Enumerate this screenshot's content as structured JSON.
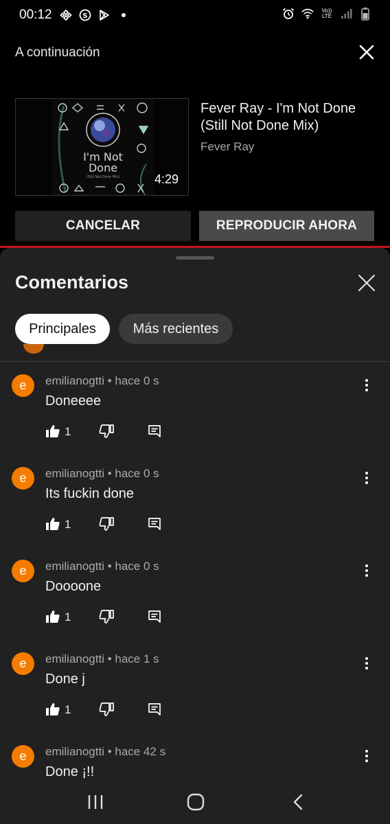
{
  "status_bar": {
    "time": "00:12",
    "left_icons": [
      "binance-icon",
      "s-app-icon",
      "play-store-icon",
      "notification-dot-icon"
    ],
    "right_icons": [
      "alarm-icon",
      "wifi-icon",
      "volte-icon",
      "signal-icon",
      "battery-icon"
    ],
    "volte_line1": "Vo))",
    "volte_line2": "LTE"
  },
  "up_next": {
    "title": "A continuación",
    "video": {
      "title": "Fever Ray - I'm Not Done (Still Not Done Mix)",
      "channel": "Fever Ray",
      "duration": "4:29",
      "thumbnail_text_line1": "I'm Not",
      "thumbnail_text_line2": "Done",
      "thumbnail_subtext": "(Still Not Done Mix)"
    },
    "cancel_label": "CANCELAR",
    "play_now_label": "REPRODUCIR AHORA"
  },
  "comments": {
    "title": "Comentarios",
    "chips": [
      {
        "label": "Principales",
        "selected": true
      },
      {
        "label": "Más recientes",
        "selected": false
      }
    ],
    "items": [
      {
        "avatar_letter": "e",
        "meta": "emilianogtti • hace 0 s",
        "text": "Doneeee",
        "likes": "1"
      },
      {
        "avatar_letter": "e",
        "meta": "emilianogtti • hace 0 s",
        "text": "Its fuckin done",
        "likes": "1"
      },
      {
        "avatar_letter": "e",
        "meta": "emilianogtti • hace 0 s",
        "text": "Doooone",
        "likes": "1"
      },
      {
        "avatar_letter": "e",
        "meta": "emilianogtti • hace 1 s",
        "text": "Done j",
        "likes": "1"
      },
      {
        "avatar_letter": "e",
        "meta": "emilianogtti • hace 42 s",
        "text": "Done ¡!!",
        "likes": ""
      }
    ]
  },
  "nav_bar": {
    "icons": [
      "recent-apps-icon",
      "home-icon",
      "back-icon"
    ]
  },
  "colors": {
    "accent_red": "#c4161c",
    "avatar_orange": "#f57c00",
    "sheet_bg": "#212121"
  }
}
